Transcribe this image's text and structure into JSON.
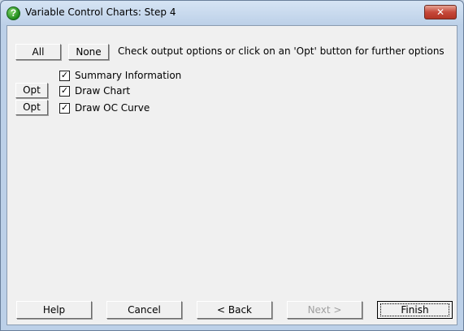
{
  "window": {
    "title": "Variable Control Charts: Step 4",
    "close_glyph": "✕"
  },
  "top_bar": {
    "all_label": "All",
    "none_label": "None",
    "instruction": "Check output options or click on an 'Opt' button for further options"
  },
  "options": [
    {
      "label": "Summary Information",
      "checked": true,
      "has_opt": false
    },
    {
      "label": "Draw Chart",
      "checked": true,
      "has_opt": true,
      "opt_label": "Opt"
    },
    {
      "label": "Draw OC Curve",
      "checked": true,
      "has_opt": true,
      "opt_label": "Opt"
    }
  ],
  "footer": {
    "help_label": "Help",
    "cancel_label": "Cancel",
    "back_label": "< Back",
    "next_label": "Next >",
    "finish_label": "Finish",
    "next_enabled": false
  }
}
